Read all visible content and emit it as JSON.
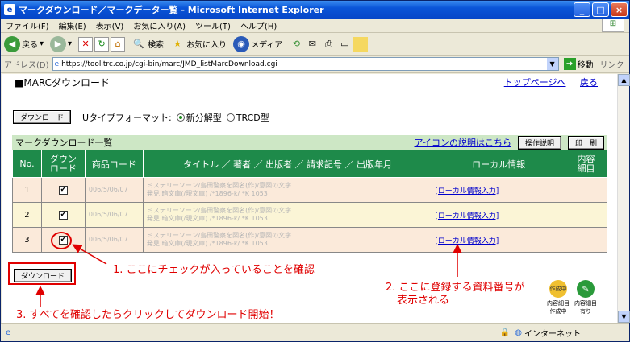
{
  "window": {
    "title": "マークダウンロード／マークデーター覧 - Microsoft Internet Explorer"
  },
  "menu": [
    "ファイル(F)",
    "編集(E)",
    "表示(V)",
    "お気に入り(A)",
    "ツール(T)",
    "ヘルプ(H)"
  ],
  "toolbar": {
    "back": "戻る",
    "search": "検索",
    "favorites": "お気に入り",
    "media": "メディア"
  },
  "address": {
    "label": "アドレス(D)",
    "url": "https://toolitrc.co.jp/cgi-bin/marc/JMD_listMarcDownload.cgi",
    "go": "移動",
    "links": "リンク"
  },
  "page": {
    "title": "■MARCダウンロード",
    "top_link": "トップページへ",
    "back_link": "戻る"
  },
  "download_button": "ダウンロード",
  "format": {
    "label": "Uタイプフォーマット:",
    "opt1": "新分解型",
    "opt2": "TRCD型"
  },
  "list": {
    "title": "マークダウンロード一覧",
    "icon_help": "アイコンの説明はこちら",
    "manual": "操作説明",
    "print": "印　刷"
  },
  "table": {
    "headers": [
      "No.",
      "ダウン\nロード",
      "商品コード",
      "タイトル ／ 著者 ／ 出版者 ／ 請求記号 ／ 出版年月",
      "ローカル情報",
      "内容\n細目"
    ],
    "rows": [
      {
        "no": "1",
        "code": "006/5/06/07",
        "title": "ミステリーソーン/島田警察を図名(作)/意図の文字\n発見 暗文庫(/現文庫) /*1896-k/ *K 1053",
        "local": "[ローカル情報入力]"
      },
      {
        "no": "2",
        "code": "006/5/06/07",
        "title": "ミステリーソーン/島田警察を図名(作)/意図の文字\n発見 暗文庫(/現文庫) /*1896-k/ *K 1053",
        "local": "[ローカル情報入力]"
      },
      {
        "no": "3",
        "code": "006/5/06/07",
        "title": "ミステリーソーン/島田警察を図名(作)/意図の文字\n発見 暗文庫(/現文庫) /*1896-k/ *K 1053",
        "local": "[ローカル情報入力]"
      }
    ]
  },
  "annotations": {
    "a1": "1. ここにチェックが入っていることを確認",
    "a2_line1": "2. ここに登録する資料番号が",
    "a2_line2": "表示される",
    "a3": "3. すべてを確認したらクリックしてダウンロード開始！"
  },
  "legend": {
    "item1_line1": "内容細目",
    "item1_line2": "作成中",
    "item2_line1": "内容細目",
    "item2_line2": "有り",
    "item1_icon": "作成中"
  },
  "status": {
    "zone": "インターネット"
  },
  "colors": {
    "header_green": "#1e8a4a",
    "row_odd": "#fbeada",
    "row_even": "#fbf5d6",
    "annotation_red": "#e00000"
  }
}
